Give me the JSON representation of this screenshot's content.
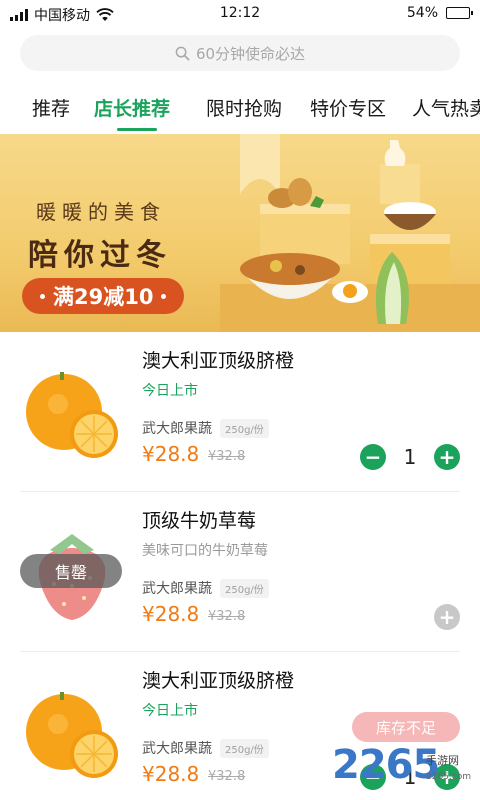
{
  "status": {
    "carrier": "中国移动",
    "time": "12:12",
    "battery": "54%",
    "battery_level": 0.54
  },
  "search": {
    "placeholder": "60分钟使命必达"
  },
  "tabs": [
    {
      "label": "推荐"
    },
    {
      "label": "店长推荐",
      "active": true
    },
    {
      "label": "限时抢购"
    },
    {
      "label": "特价专区"
    },
    {
      "label": "人气热卖"
    }
  ],
  "banner": {
    "line1": "暖暖的美食",
    "line2": "陪你过冬",
    "promo": "满29减10"
  },
  "products": [
    {
      "name": "澳大利亚顶级脐橙",
      "tag": "今日上市",
      "shop": "武大郎果蔬",
      "unit": "250g/份",
      "price": "¥28.8",
      "old_price": "¥32.8",
      "qty": "1"
    },
    {
      "name": "顶级牛奶草莓",
      "tag": "美味可口的牛奶草莓",
      "shop": "武大郎果蔬",
      "unit": "250g/份",
      "price": "¥28.8",
      "old_price": "¥32.8",
      "badge": "售罄"
    },
    {
      "name": "澳大利亚顶级脐橙",
      "tag": "今日上市",
      "shop": "武大郎果蔬",
      "unit": "250g/份",
      "price": "¥28.8",
      "old_price": "¥32.8",
      "qty": "1",
      "stock_notice": "库存不足"
    }
  ],
  "watermark": {
    "number": "2265",
    "site": "手游网",
    "url": "2265.com"
  },
  "colors": {
    "accent": "#1ba35c",
    "price": "#f07b14",
    "promo": "#d8531f"
  }
}
